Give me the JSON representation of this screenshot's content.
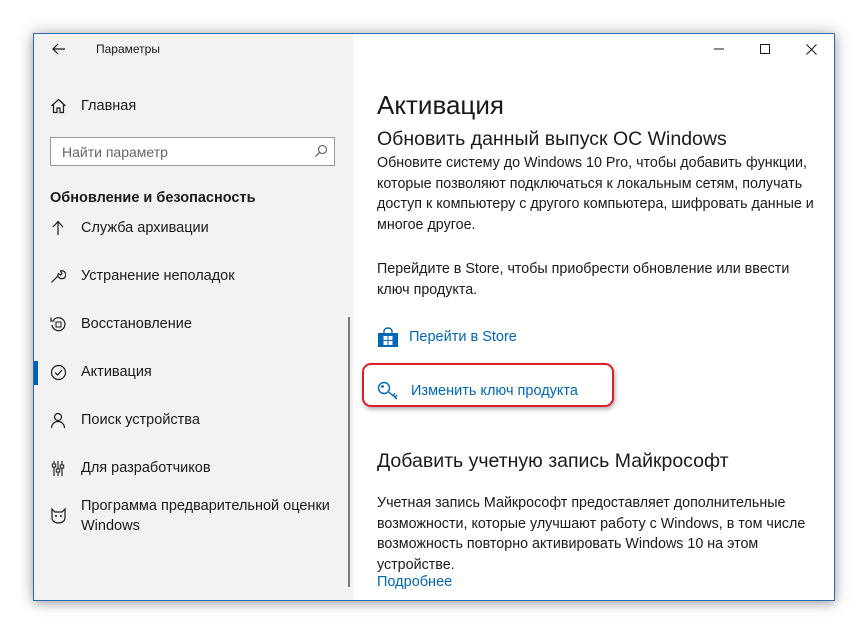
{
  "window": {
    "title": "Параметры",
    "accent": "#0063b1",
    "link_color": "#0067b8",
    "highlight_color": "#d8202a"
  },
  "sidebar": {
    "home_label": "Главная",
    "search_placeholder": "Найти параметр",
    "section_title": "Обновление и безопасность",
    "items": [
      {
        "label": "Служба архивации",
        "icon": "upload-arrow-icon"
      },
      {
        "label": "Устранение неполадок",
        "icon": "wrench-icon"
      },
      {
        "label": "Восстановление",
        "icon": "recovery-icon"
      },
      {
        "label": "Активация",
        "icon": "check-circle-icon",
        "active": true
      },
      {
        "label": "Поиск устройства",
        "icon": "person-pin-icon"
      },
      {
        "label": "Для разработчиков",
        "icon": "developer-sliders-icon"
      },
      {
        "label": "Программа предварительной оценки Windows",
        "icon": "insider-cat-icon"
      }
    ]
  },
  "main": {
    "page_title": "Активация",
    "upgrade": {
      "heading": "Обновить данный выпуск ОС Windows",
      "description": "Обновите систему до Windows 10 Pro, чтобы добавить функции, которые позволяют подключаться к локальным сетям, получать доступ к компьютеру с другого компьютера, шифровать данные и многое другое.",
      "store_text": "Перейдите в Store, чтобы приобрести обновление или ввести ключ продукта.",
      "store_link": "Перейти в Store",
      "change_key_link": "Изменить ключ продукта"
    },
    "microsoft_account": {
      "heading": "Добавить учетную запись Майкрософт",
      "description": "Учетная запись Майкрософт предоставляет дополнительные возможности, которые улучшают работу с Windows, в том числе возможность повторно активировать Windows 10 на этом устройстве.",
      "more_link": "Подробнее"
    }
  }
}
